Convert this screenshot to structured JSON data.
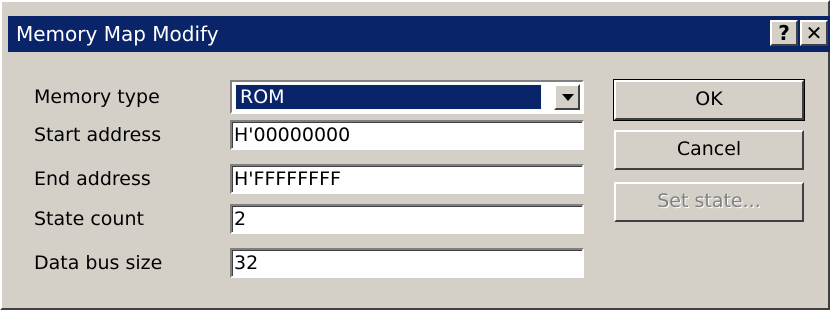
{
  "window": {
    "title": "Memory Map Modify",
    "help_label": "?",
    "close_label": "✕"
  },
  "form": {
    "memory_type": {
      "label": "Memory type",
      "value": "ROM"
    },
    "start_address": {
      "label": "Start address",
      "value": "H'00000000"
    },
    "end_address": {
      "label": "End address",
      "value": "H'FFFFFFFF"
    },
    "state_count": {
      "label": "State count",
      "value": "2"
    },
    "data_bus_size": {
      "label": "Data bus size",
      "value": "32"
    }
  },
  "buttons": {
    "ok": "OK",
    "cancel": "Cancel",
    "set_state": "Set state..."
  },
  "colors": {
    "title_bar": "#0a246a",
    "face": "#d4d0c8",
    "disabled_text": "#808080"
  }
}
